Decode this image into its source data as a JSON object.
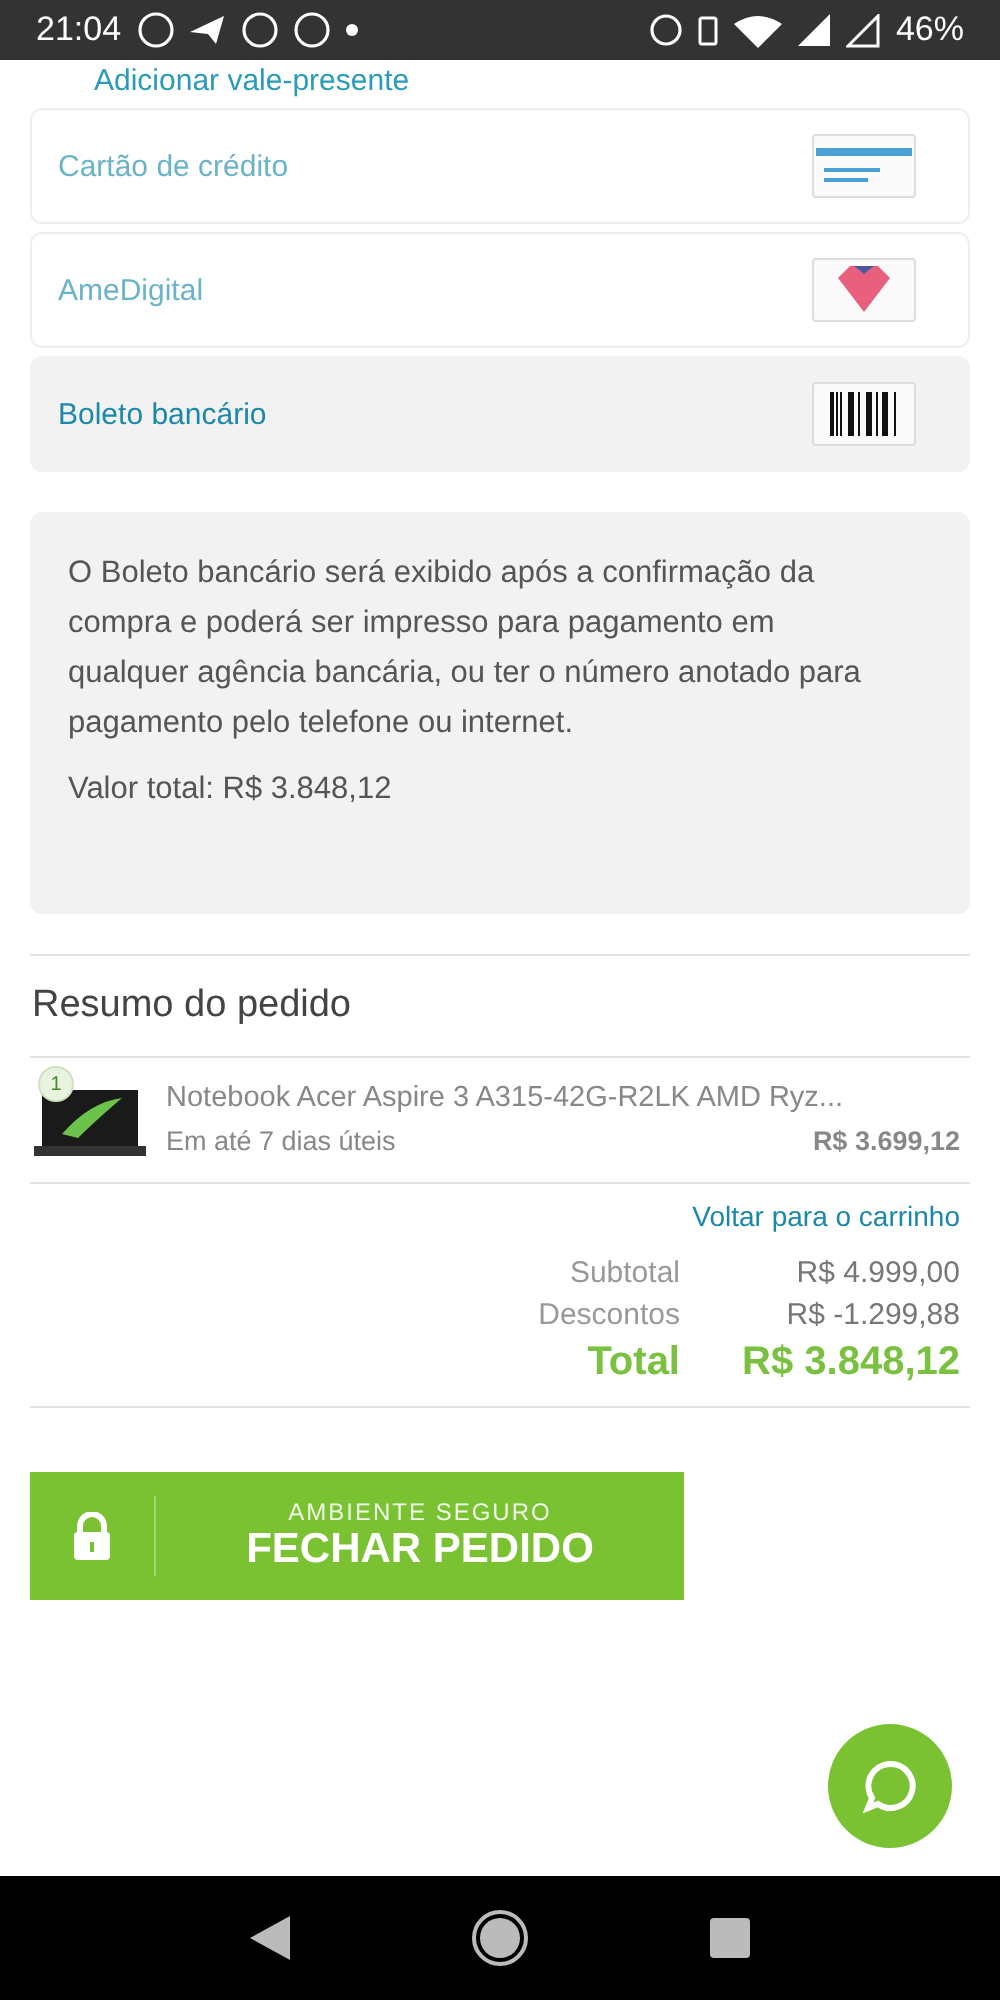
{
  "status_bar": {
    "time": "21:04",
    "battery": "46%"
  },
  "gift_link": "Adicionar vale-presente",
  "payment_methods": [
    {
      "label": "Cartão de crédito",
      "kind": "card",
      "selected": false
    },
    {
      "label": "AmeDigital",
      "kind": "ame",
      "selected": false
    },
    {
      "label": "Boleto bancário",
      "kind": "boleto",
      "selected": true
    }
  ],
  "boleto_info": {
    "text": "O Boleto bancário será exibido após a confirmação da compra e poderá ser impresso para pagamento em qualquer agência bancária, ou ter o número anotado para pagamento pelo telefone ou internet.",
    "total": "Valor total: R$ 3.848,12"
  },
  "summary": {
    "title": "Resumo do pedido",
    "items": [
      {
        "quantity": "1",
        "name": "Notebook Acer Aspire 3 A315-42G-R2LK AMD Ryz...",
        "delivery": "Em até 7 dias úteis",
        "price": "R$ 3.699,12"
      }
    ],
    "back_link": "Voltar para o carrinho",
    "totals": [
      {
        "label": "Subtotal",
        "value": "R$ 4.999,00",
        "kind": "line"
      },
      {
        "label": "Descontos",
        "value": "R$ -1.299,88",
        "kind": "line"
      },
      {
        "label": "Total",
        "value": "R$ 3.848,12",
        "kind": "grand"
      }
    ]
  },
  "checkout_button": {
    "caption": "AMBIENTE SEGURO",
    "label": "FECHAR PEDIDO"
  }
}
